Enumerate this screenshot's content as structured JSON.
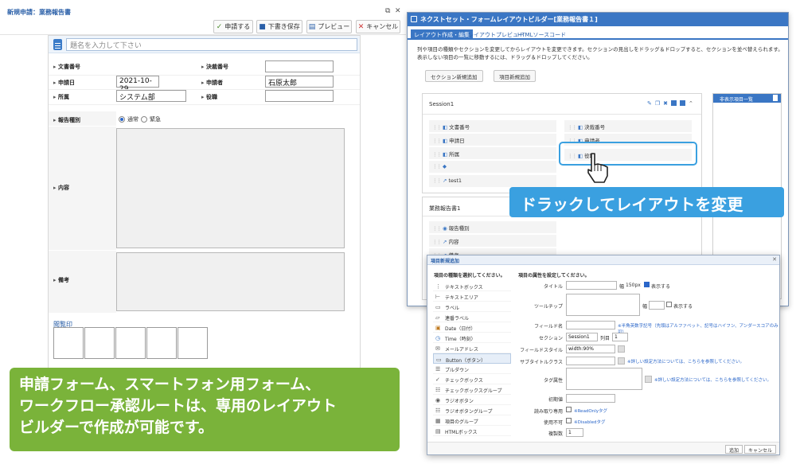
{
  "left_app": {
    "title": "新規申請：業務報告書",
    "toolbar": {
      "apply": "申請する",
      "draft_save": "下書き保存",
      "preview": "プレビュー",
      "cancel": "キャンセル"
    },
    "title_placeholder": "題名を入力して下さい",
    "fields": {
      "doc_no_label": "文書番号",
      "approval_no_label": "決裁番号",
      "apply_date_label": "申請日",
      "apply_date_value": "2021-10-29",
      "applicant_label": "申請者",
      "applicant_value": "石原太郎",
      "dept_label": "所属",
      "dept_value": "システム部",
      "position_label": "役職",
      "report_type_label": "報告種別",
      "radio_normal": "通常",
      "radio_urgent": "緊急",
      "content_label": "内容",
      "remarks_label": "備考"
    },
    "approval_label": "閲覧印",
    "banner_line1": "申請フォーム、スマートフォン用フォーム、",
    "banner_line2": "ワークフロー承認ルートは、専用のレイアウト",
    "banner_line3": "ビルダーで作成が可能です。"
  },
  "builder": {
    "title": "ネクストセット・フォームレイアウトビルダー[業務報告書１]",
    "tabs": [
      "レイアウト作成・編集",
      "レイアウトプレビュー",
      "HTMLソースコード"
    ],
    "desc_line1": "列や項目の種類やセクションを変更してからレイアウトを変更できます。セクションの見出しをドラッグ＆ドロップすると、セクションを並べ替えられます。",
    "desc_line2": "表示しない項目の一覧に移動するには、ドラッグ＆ドロップしてください。",
    "add_section": "セクション新規追加",
    "add_item": "項目新規追加",
    "session1_name": "Session1",
    "session1_items_left": [
      "文書番号",
      "申請日",
      "所属",
      "",
      "test1"
    ],
    "session1_items_right": [
      "決裁番号",
      "申請者",
      "役職"
    ],
    "session2_name": "業務報告書1",
    "session2_items": [
      "報告種別",
      "内容",
      "備考"
    ],
    "unused_title": "非表示項目一覧",
    "callout": "ドラックしてレイアウトを変更"
  },
  "dialog": {
    "title": "項目新規追加",
    "left_heading": "項目の種類を選択してください。",
    "right_heading": "項目の属性を設定してください。",
    "types": [
      "テキストボックス",
      "テキストエリア",
      "ラベル",
      "連番ラベル",
      "Date（日付）",
      "Time（時刻）",
      "メールアドレス",
      "Button（ボタン）",
      "プルダウン",
      "チェックボックス",
      "チェックボックスグループ",
      "ラジオボタン",
      "ラジオボタングループ",
      "項目のグループ",
      "HTMLボックス"
    ],
    "selected_type_index": 7,
    "title_label": "タイトル",
    "width_label": "幅",
    "width_value": "150px",
    "show_label": "表示する",
    "tooltip_label": "ツールチップ",
    "tooltip_show": "表示する",
    "field_name_label": "フィールド名",
    "field_name_note": "※半角英数字記号（先頭はアルファベット、記号はハイフン、アンダースコアのみ可）",
    "section_label": "セクション",
    "section_value": "Session1",
    "column_label": "列目",
    "column_value": "1",
    "field_style_label": "フィールドスタイル",
    "field_style_value": "width:90%",
    "subtitle_class_label": "サブタイトルクラス",
    "detail_note1": "※詳しい設定方法については、こちらを参照してください。",
    "tag_attr_label": "タグ属性",
    "detail_note2": "※詳しい設定方法については、こちらを参照してください。",
    "initial_label": "初期値",
    "readonly_label": "読み取り専用",
    "readonly_note": "※ReadOnlyタグ",
    "disabled_label": "使用不可",
    "disabled_note": "※Disabledタグ",
    "copies_label": "複製数",
    "copies_value": "1",
    "add_button": "追加",
    "cancel_button": "キャンセル"
  },
  "colors": {
    "accent_blue": "#3a76c4",
    "callout_blue": "#3aa0e0",
    "banner_green": "#7ab33a"
  }
}
